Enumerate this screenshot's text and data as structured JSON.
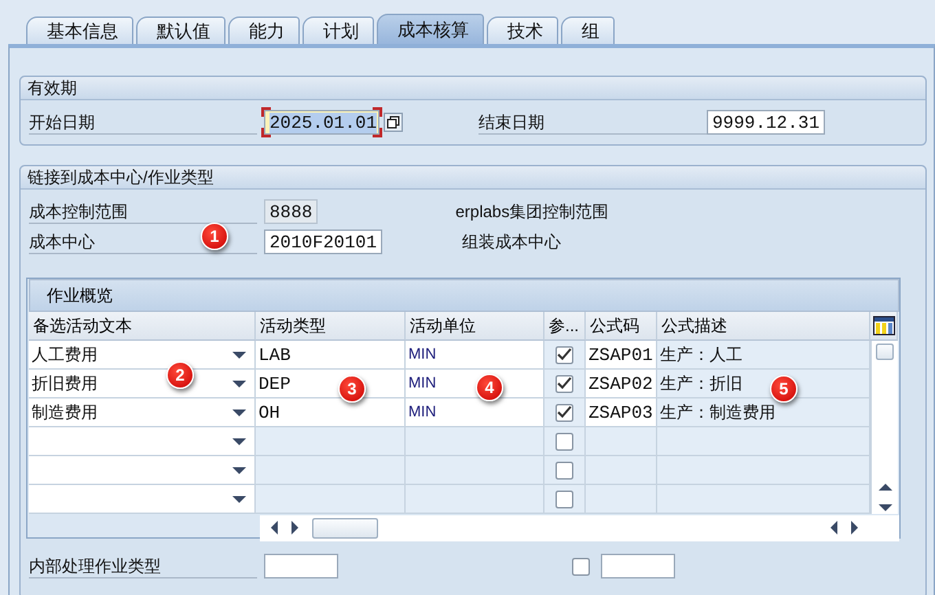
{
  "tabs": [
    {
      "label": "基本信息",
      "selected": false
    },
    {
      "label": "默认值",
      "selected": false
    },
    {
      "label": "能力",
      "selected": false
    },
    {
      "label": "计划",
      "selected": false
    },
    {
      "label": "成本核算",
      "selected": true
    },
    {
      "label": "技术",
      "selected": false
    },
    {
      "label": "组",
      "selected": false
    }
  ],
  "validity": {
    "title": "有效期",
    "start_label": "开始日期",
    "start_value": "2025.01.01",
    "start_focused": true,
    "end_label": "结束日期",
    "end_value": "9999.12.31"
  },
  "link": {
    "title": "链接到成本中心/作业类型",
    "fields": [
      {
        "label": "成本控制范围",
        "value": "8888",
        "readonly": true,
        "description": "erplabs集团控制范围"
      },
      {
        "label": "成本中心",
        "value": "2010F20101",
        "readonly": false,
        "description": "组装成本中心"
      }
    ]
  },
  "overview": {
    "title": "作业概览",
    "columns": [
      "备选活动文本",
      "活动类型",
      "活动单位",
      "参...",
      "公式码",
      "公式描述"
    ],
    "rows": [
      {
        "alt_text": "人工费用",
        "activity_type": "LAB",
        "unit": "MIN",
        "checked": true,
        "formula_code": "ZSAP01",
        "formula_desc": "生产：人工"
      },
      {
        "alt_text": "折旧费用",
        "activity_type": "DEP",
        "unit": "MIN",
        "checked": true,
        "formula_code": "ZSAP02",
        "formula_desc": "生产：折旧"
      },
      {
        "alt_text": "制造费用",
        "activity_type": "OH",
        "unit": "MIN",
        "checked": true,
        "formula_code": "ZSAP03",
        "formula_desc": "生产：制造费用"
      },
      {
        "checked": false
      },
      {
        "checked": false
      },
      {
        "checked": false
      }
    ]
  },
  "internal": {
    "label": "内部处理作业类型",
    "checked": false
  },
  "markers": [
    "1",
    "2",
    "3",
    "4",
    "5"
  ]
}
